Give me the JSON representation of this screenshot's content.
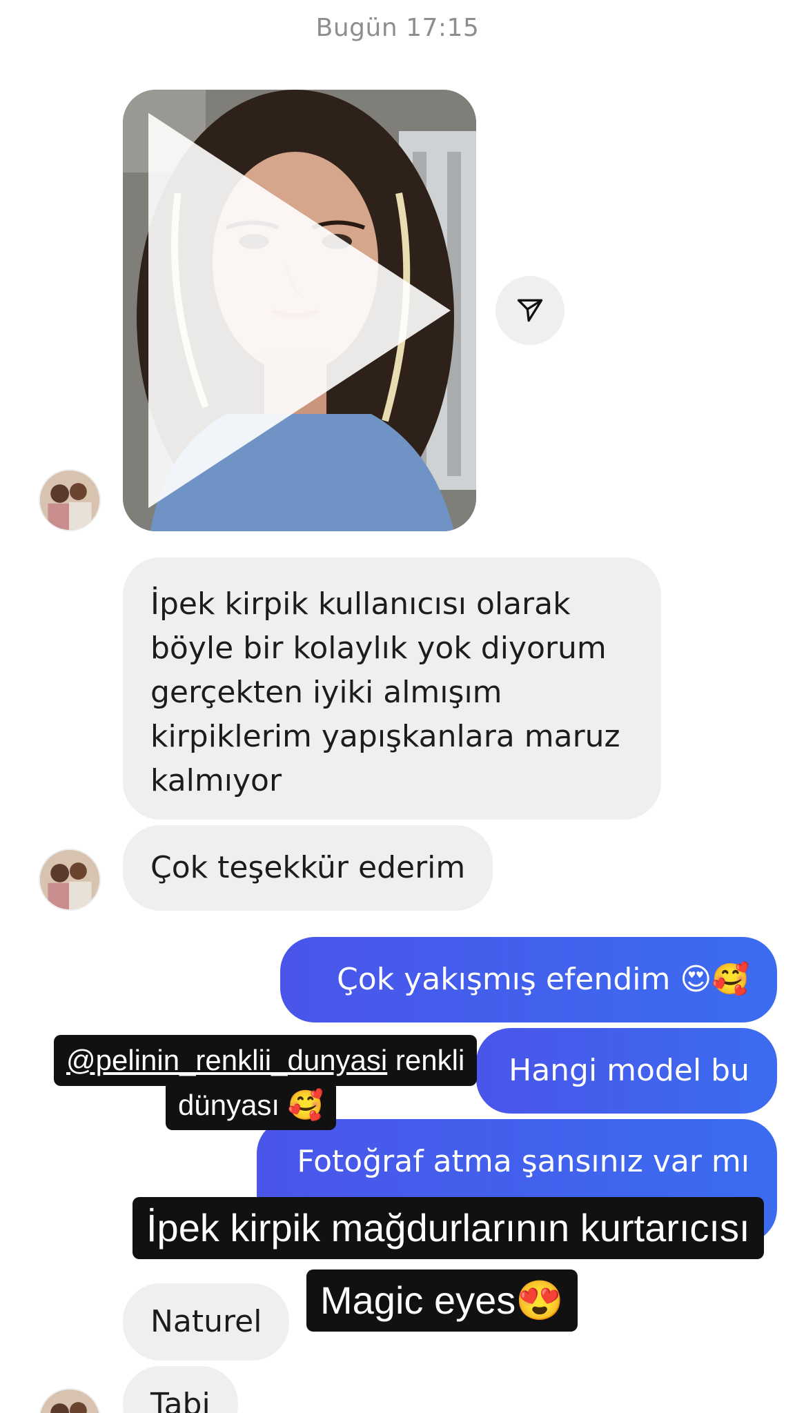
{
  "timestamp": "Bugün 17:15",
  "video": {
    "play_icon": "play-icon"
  },
  "share": {
    "icon": "paper-plane-icon"
  },
  "messages": {
    "m1": "İpek kirpik kullanıcısı olarak böyle bir kolaylık yok diyorum gerçekten iyiki almışım kirpiklerim yapışkanlara maruz kalmıyor",
    "m2": "Çok teşekkür ederim",
    "m3": "Çok yakışmış efendim 😍🥰",
    "m4": "Hangi model bu",
    "m5": "Fotoğraf atma şansınız var mı",
    "m6": "Naturel",
    "m7": "Tabi"
  },
  "stickers": {
    "mention_handle": "@pelinin_renklii_dunyasi",
    "mention_rest": " renkli",
    "mention_line2": "dünyası 🥰",
    "caption_line1": "İpek kirpik mağdurlarının kurtarıcısı",
    "caption_line2": "Magic eyes😍"
  },
  "colors": {
    "outgoing_bubble": "#3d5ef0",
    "incoming_bubble": "#efefef",
    "timestamp": "#8e8e8e"
  }
}
